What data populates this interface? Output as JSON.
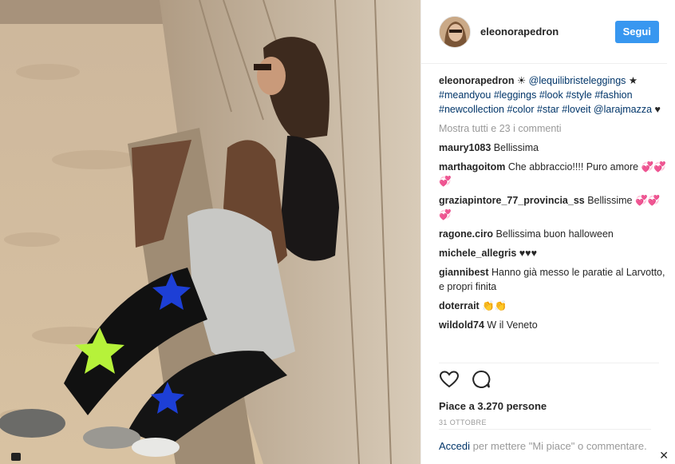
{
  "header": {
    "username": "eleonorapedron",
    "follow_label": "Segui"
  },
  "caption": {
    "username": "eleonorapedron",
    "parts": [
      {
        "type": "text",
        "value": " ☀ "
      },
      {
        "type": "tag",
        "value": "@lequilibristeleggings"
      },
      {
        "type": "text",
        "value": " ★ "
      },
      {
        "type": "tag",
        "value": "#meandyou"
      },
      {
        "type": "text",
        "value": " "
      },
      {
        "type": "tag",
        "value": "#leggings"
      },
      {
        "type": "text",
        "value": " "
      },
      {
        "type": "tag",
        "value": "#look"
      },
      {
        "type": "text",
        "value": " "
      },
      {
        "type": "tag",
        "value": "#style"
      },
      {
        "type": "text",
        "value": " "
      },
      {
        "type": "tag",
        "value": "#fashion"
      },
      {
        "type": "text",
        "value": " "
      },
      {
        "type": "tag",
        "value": "#newcollection"
      },
      {
        "type": "text",
        "value": " "
      },
      {
        "type": "tag",
        "value": "#color"
      },
      {
        "type": "text",
        "value": " "
      },
      {
        "type": "tag",
        "value": "#star"
      },
      {
        "type": "text",
        "value": " "
      },
      {
        "type": "tag",
        "value": "#loveit"
      },
      {
        "type": "text",
        "value": " "
      },
      {
        "type": "tag",
        "value": "@larajmazza"
      },
      {
        "type": "text",
        "value": " ♥"
      }
    ]
  },
  "show_all_comments": "Mostra tutti e 23 i commenti",
  "comments": [
    {
      "user": "maury1083",
      "text": "Bellissima"
    },
    {
      "user": "marthagoitom",
      "text": "Che abbraccio!!!! Puro amore 💞💞💞"
    },
    {
      "user": "graziapintore_77_provincia_ss",
      "text": "Bellissime 💞💞💞"
    },
    {
      "user": "ragone.ciro",
      "text": "Bellissima buon halloween"
    },
    {
      "user": "michele_allegris",
      "text": "♥♥♥"
    },
    {
      "user": "giannibest",
      "text": "Hanno già messo le paratie al Larvotto, e propri finita"
    },
    {
      "user": "doterrait",
      "text": "👏👏"
    },
    {
      "user": "wildold74",
      "text": "W il Veneto"
    }
  ],
  "icons": {
    "like": "heart-outline-icon",
    "comment": "speech-bubble-icon"
  },
  "likes_text": "Piace a 3.270 persone",
  "date_text": "31 OTTOBRE",
  "login": {
    "link_label": "Accedi",
    "rest": " per mettere \"Mi piace\" o commentare."
  },
  "close_glyph": "✕",
  "colors": {
    "accent": "#3897f0",
    "link": "#003569",
    "muted": "#999999",
    "star_blue": "#1d3fd6",
    "star_green": "#b6f23a"
  }
}
